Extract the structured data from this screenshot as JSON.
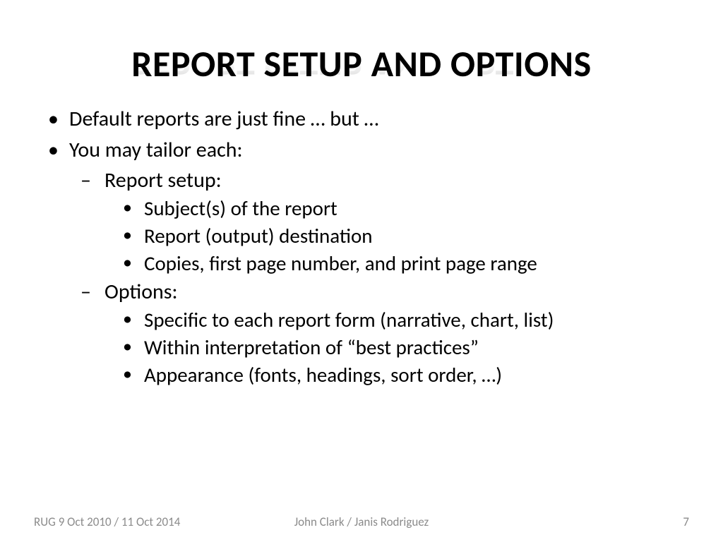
{
  "title": "REPORT SETUP AND OPTIONS",
  "bullets": {
    "b1": "Default reports are just fine … but …",
    "b2": "You may tailor each:",
    "b2a": "Report setup:",
    "b2a1": "Subject(s) of the report",
    "b2a2": "Report (output) destination",
    "b2a3": "Copies, first page number, and print page range",
    "b2b": "Options:",
    "b2b1": "Specific to each report form (narrative, chart, list)",
    "b2b2": "Within interpretation of “best practices”",
    "b2b3": "Appearance (fonts, headings, sort order, …)"
  },
  "footer": {
    "left": "RUG 9 Oct 2010 / 11 Oct 2014",
    "center": "John Clark / Janis Rodriguez",
    "right": "7"
  }
}
